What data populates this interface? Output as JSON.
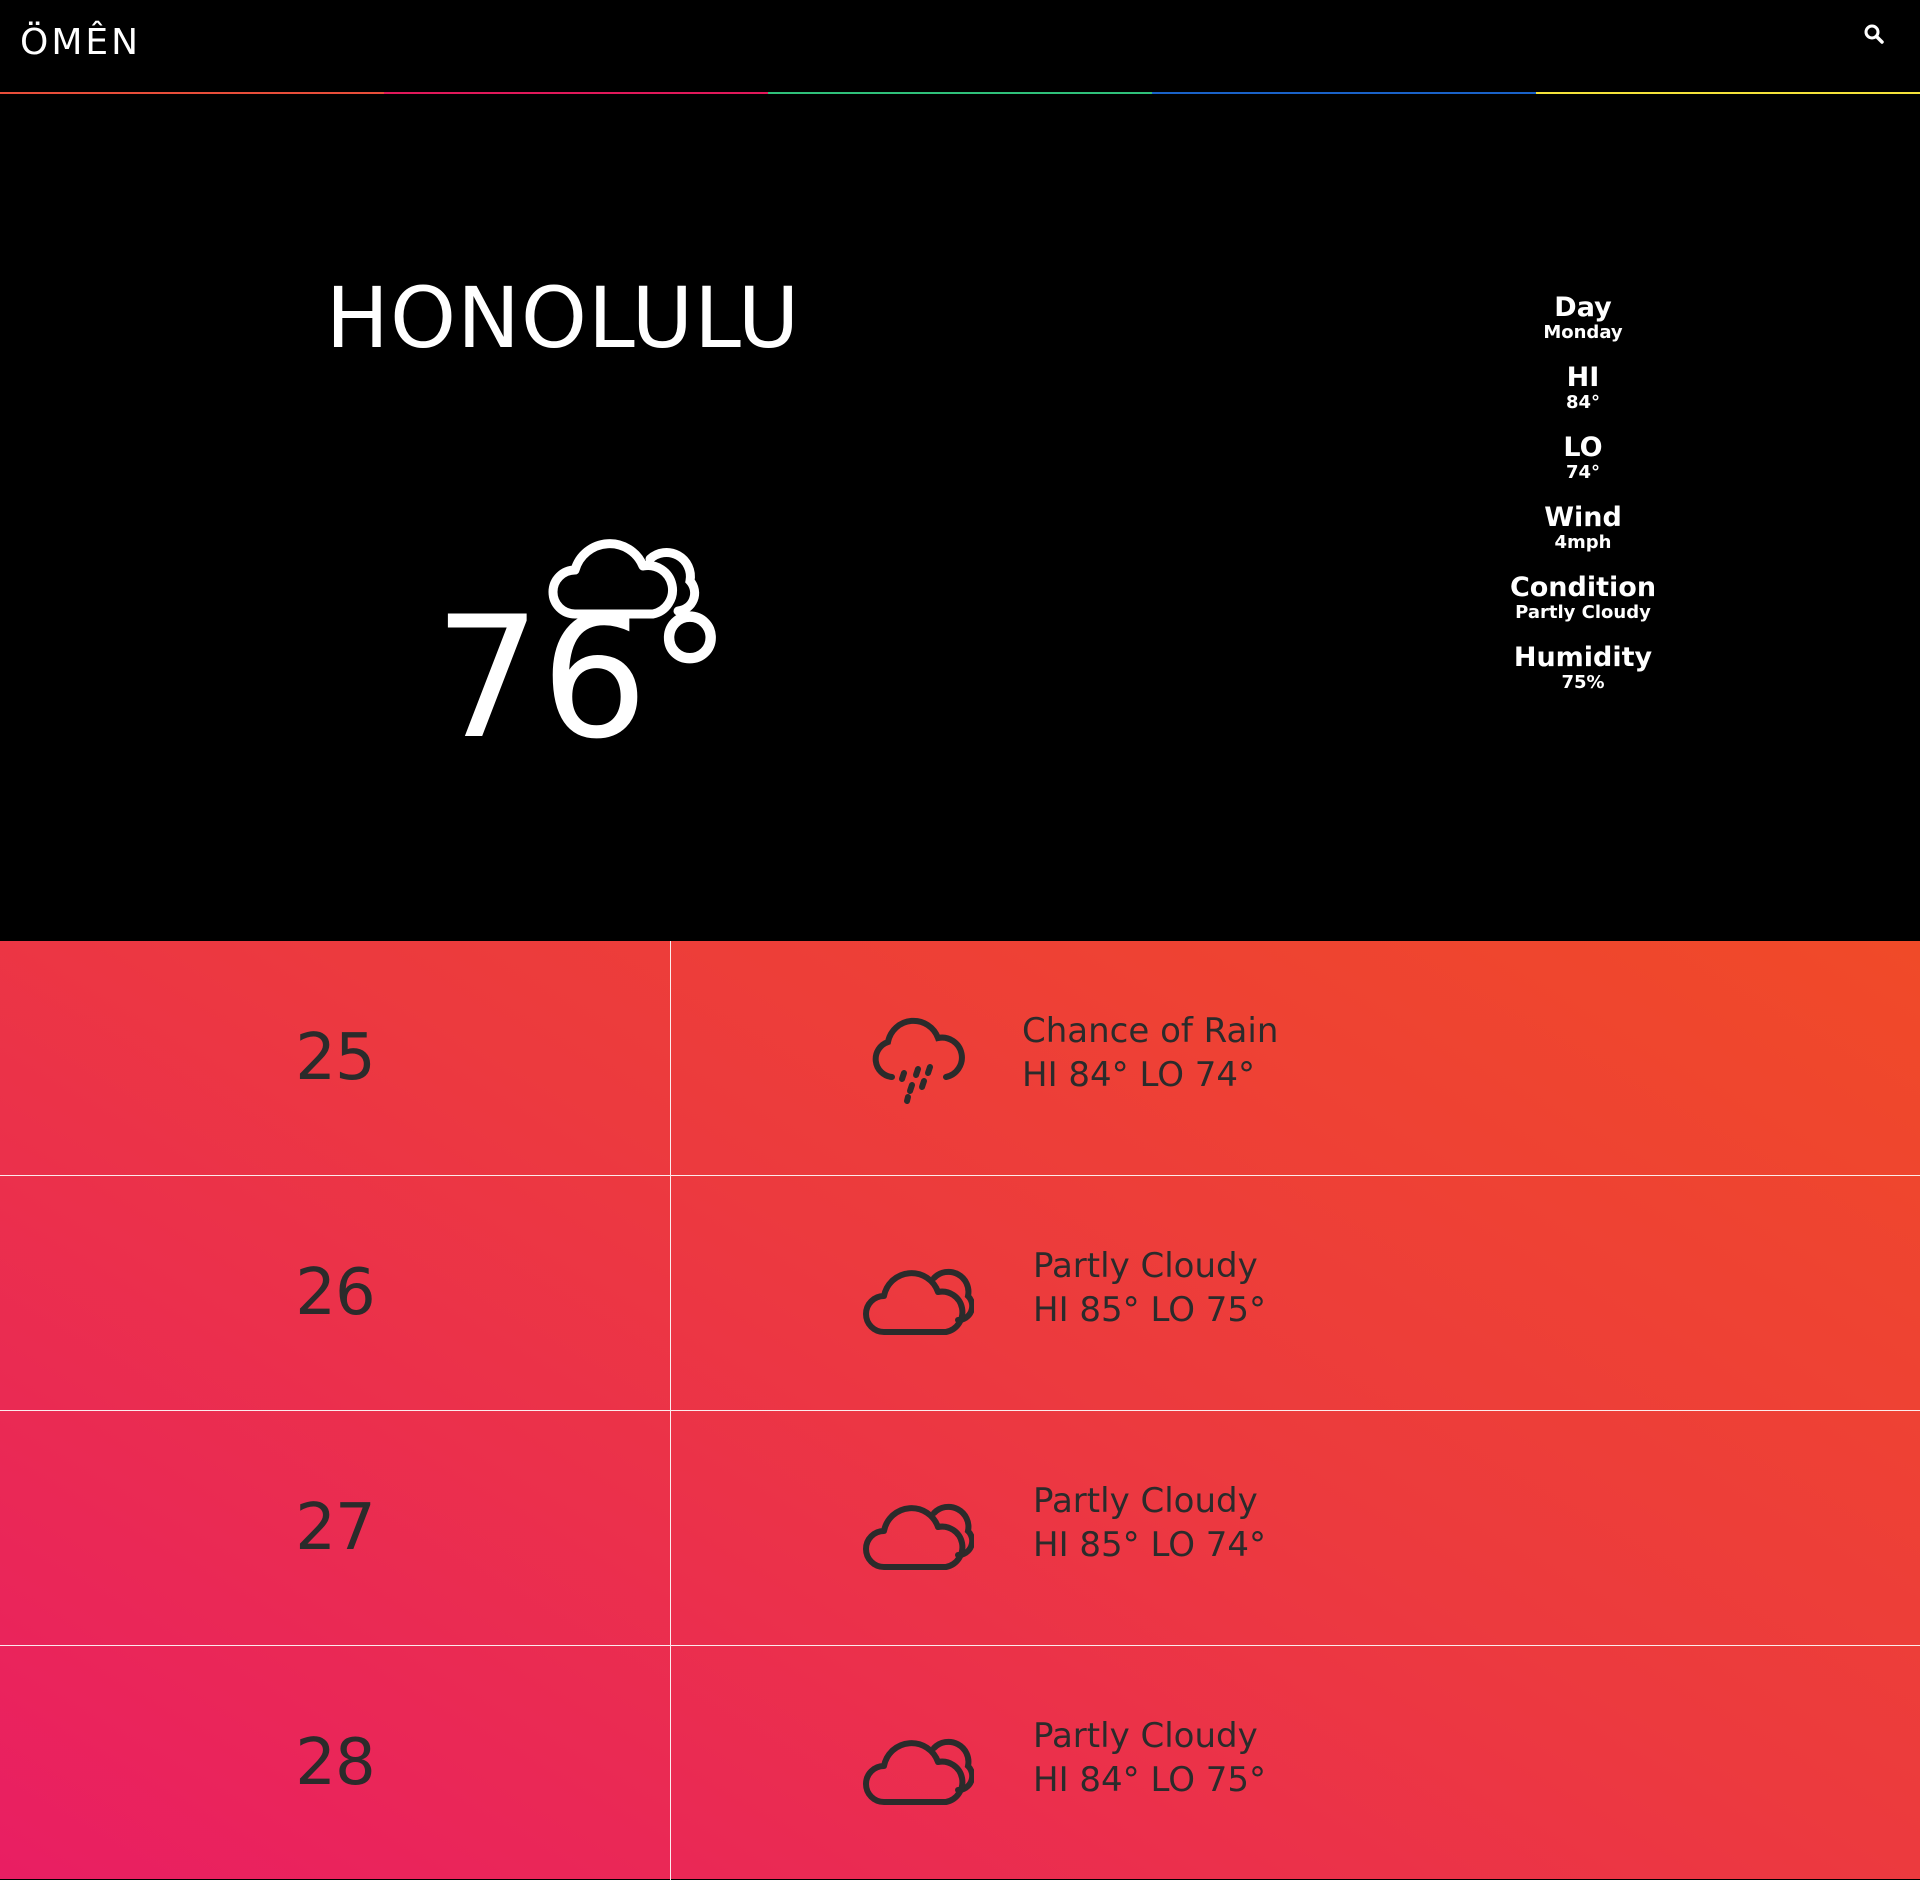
{
  "header": {
    "logo": "ÖMÊN",
    "search_icon": "search-icon",
    "stripe_colors": [
      "#e94e3a",
      "#e0185a",
      "#2fc07a",
      "#1a62c8",
      "#f4e23a"
    ]
  },
  "current": {
    "city": "HONOLULU",
    "icon": "partly-cloudy-icon",
    "temperature": "76°",
    "details": [
      {
        "label": "Day",
        "value": "Monday"
      },
      {
        "label": "HI",
        "value": "84°"
      },
      {
        "label": "LO",
        "value": "74°"
      },
      {
        "label": "Wind",
        "value": "4mph"
      },
      {
        "label": "Condition",
        "value": "Partly Cloudy"
      },
      {
        "label": "Humidity",
        "value": "75%"
      }
    ]
  },
  "forecast": [
    {
      "day": "25",
      "icon": "rain-icon",
      "condition": "Chance of Rain",
      "hilo": "HI 84° LO 74°"
    },
    {
      "day": "26",
      "icon": "partly-cloudy-icon",
      "condition": "Partly Cloudy",
      "hilo": "HI 85° LO 75°"
    },
    {
      "day": "27",
      "icon": "partly-cloudy-icon",
      "condition": "Partly Cloudy",
      "hilo": "HI 85° LO 74°"
    },
    {
      "day": "28",
      "icon": "partly-cloudy-icon",
      "condition": "Partly Cloudy",
      "hilo": "HI 84° LO 75°"
    }
  ],
  "colors": {
    "forecast_gradient_start": "#e91e63",
    "forecast_gradient_end": "#f04a28",
    "forecast_text": "#2b2b2b"
  }
}
